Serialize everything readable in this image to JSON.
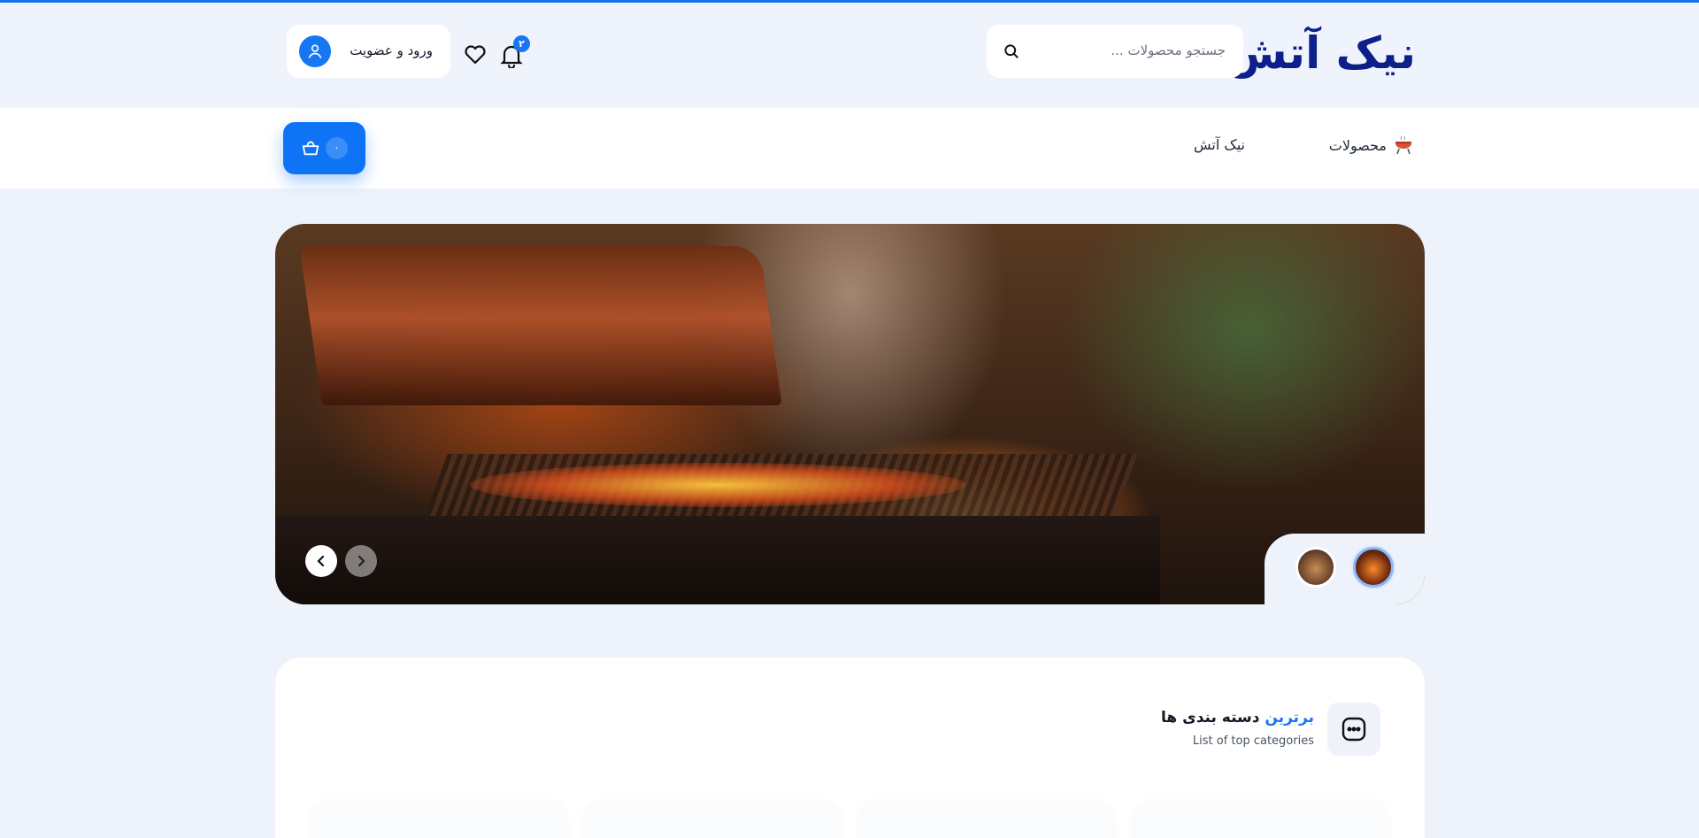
{
  "header": {
    "logo": "نیک آتش",
    "search_placeholder": "جستجو محصولات ...",
    "login_label": "ورود و عضویت",
    "notification_count": "۲"
  },
  "nav": {
    "products_label": "محصولات",
    "brand_label": "نیک آتش",
    "cart_count": "۰"
  },
  "hero": {
    "slide_count": 2,
    "active_slide": 2
  },
  "categories": {
    "title_accent": "برترین",
    "title_rest": "دسته بندی ها",
    "subtitle": "List of top categories"
  },
  "colors": {
    "accent": "#1676f3",
    "logo": "#0f1f8a",
    "background": "#eef3fb"
  },
  "icons": [
    "search-icon",
    "user-icon",
    "heart-icon",
    "bell-icon",
    "grill-icon",
    "basket-icon",
    "chevron-left-icon",
    "chevron-right-icon",
    "chat-dots-icon"
  ]
}
